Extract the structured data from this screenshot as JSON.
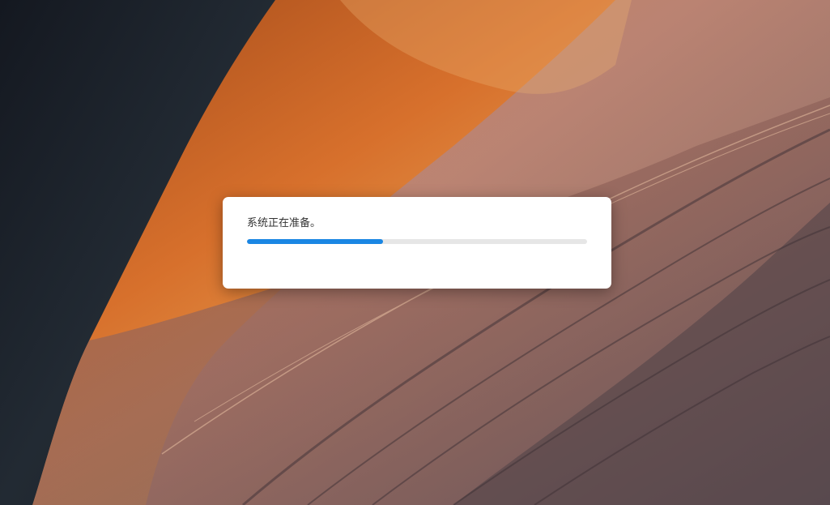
{
  "dialog": {
    "message": "系统正在准备。",
    "progress": 0.4
  },
  "colors": {
    "dialog_background": "#ffffff",
    "progress_fill": "#1a86e3",
    "progress_track": "#e6e6e6",
    "message_text": "#333333"
  }
}
